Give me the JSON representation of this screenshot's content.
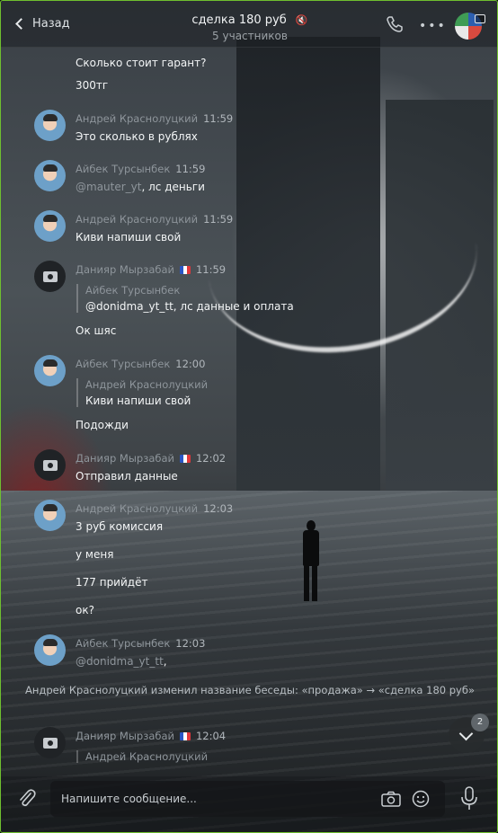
{
  "header": {
    "back_label": "Назад",
    "chat_title": "сделка 180 руб",
    "participants": "5 участников"
  },
  "messages": [
    {
      "type": "text_only",
      "text": "Сколько стоит гарант?"
    },
    {
      "type": "text_only",
      "text": "300тг"
    },
    {
      "author": "Андрей Краснолуцкий",
      "time": "11:59",
      "text": "Это сколько в рублях"
    },
    {
      "author": "Айбек Турсынбек",
      "time": "11:59",
      "mention": "@mauter_yt",
      "text_after": ", лс деньги"
    },
    {
      "author": "Андрей Краснолуцкий",
      "time": "11:59",
      "text": "Киви напиши свой"
    },
    {
      "author": "Данияр Мырзабай",
      "time": "11:59",
      "reply_name": "Айбек Турсынбек",
      "reply_text": "@donidma_yt_tt, лс данные и оплата",
      "text": "Ок шяс"
    },
    {
      "author": "Айбек Турсынбек",
      "time": "12:00",
      "reply_name": "Андрей Краснолуцкий",
      "reply_text": "Киви напиши свой",
      "text": "Подожди"
    },
    {
      "author": "Данияр Мырзабай",
      "time": "12:02",
      "text": "Отправил данные"
    },
    {
      "author": "Андрей Краснолуцкий",
      "time": "12:03",
      "lines": [
        "3 руб комиссия",
        "у меня",
        "177 прийдёт",
        "ок?"
      ]
    },
    {
      "author": "Айбек Турсынбек",
      "time": "12:03",
      "mention": "@donidma_yt_tt",
      "text_after": ","
    },
    {
      "author": "Данияр Мырзабай",
      "time": "12:04",
      "reply_name": "Андрей Краснолуцкий"
    }
  ],
  "service_message": "Андрей Краснолуцкий изменил название беседы: «продажа» → «сделка 180 руб»",
  "scroll": {
    "unread_count": "2"
  },
  "composer": {
    "placeholder": "Напишите сообщение..."
  }
}
